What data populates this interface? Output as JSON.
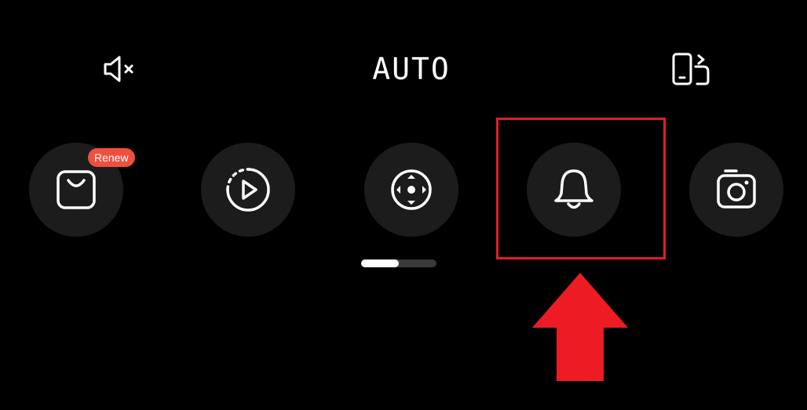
{
  "top_row": {
    "mute_icon": "speaker-muted-icon",
    "mode_label": "AUTO",
    "rotate_icon": "screen-rotate-icon"
  },
  "quick_actions": [
    {
      "name": "shop",
      "icon": "shopping-bag-icon",
      "badge": "Renew"
    },
    {
      "name": "playback",
      "icon": "playback-icon"
    },
    {
      "name": "pan-control",
      "icon": "direction-pad-icon"
    },
    {
      "name": "notifications",
      "icon": "bell-icon"
    },
    {
      "name": "snapshot",
      "icon": "camera-icon"
    }
  ],
  "pager": {
    "progress": 0.5
  },
  "annotation": {
    "highlight_color": "#e31e24",
    "arrow_color": "#ed1c24",
    "highlighted_item": "notifications"
  },
  "colors": {
    "background": "#000000",
    "button_background": "#1c1c1c",
    "badge_background": "#ef4f3f",
    "icon_color": "#ffffff"
  }
}
